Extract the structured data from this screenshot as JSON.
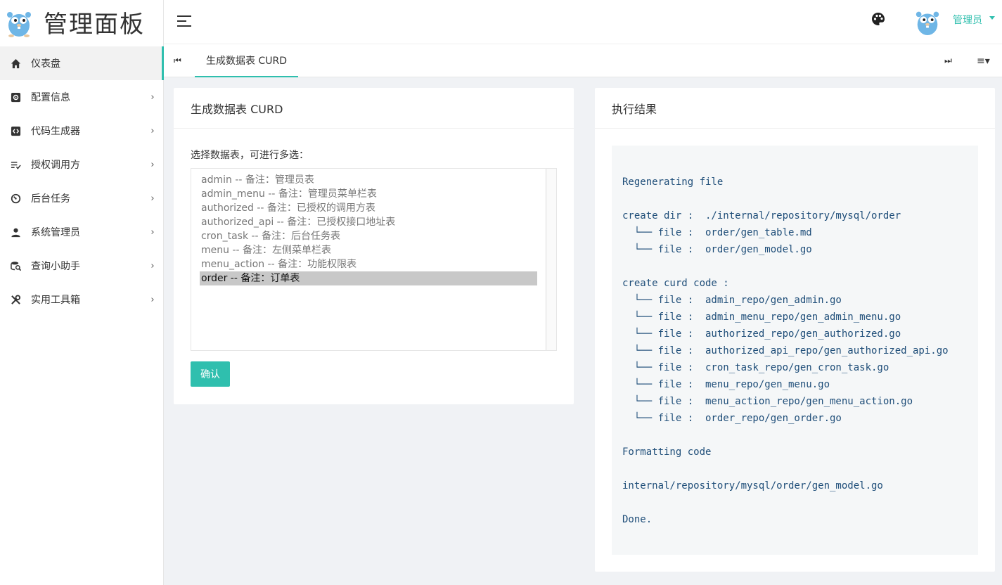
{
  "brand": {
    "title": "管理面板",
    "logo_icon": "gopher-logo-icon"
  },
  "sidebar": {
    "items": [
      {
        "label": "仪表盘",
        "icon": "home-icon",
        "active": true,
        "has_arrow": false
      },
      {
        "label": "配置信息",
        "icon": "settings-box-icon",
        "active": false,
        "has_arrow": true
      },
      {
        "label": "代码生成器",
        "icon": "code-icon",
        "active": false,
        "has_arrow": true
      },
      {
        "label": "授权调用方",
        "icon": "list-check-icon",
        "active": false,
        "has_arrow": true
      },
      {
        "label": "后台任务",
        "icon": "timer-icon",
        "active": false,
        "has_arrow": true
      },
      {
        "label": "系统管理员",
        "icon": "user-icon",
        "active": false,
        "has_arrow": true
      },
      {
        "label": "查询小助手",
        "icon": "search-database-icon",
        "active": false,
        "has_arrow": true
      },
      {
        "label": "实用工具箱",
        "icon": "tools-icon",
        "active": false,
        "has_arrow": true
      }
    ],
    "arrow": "›"
  },
  "header": {
    "user_name": "管理员"
  },
  "tabs": {
    "prev": "⏮",
    "next": "⏭",
    "menu": "≡▾",
    "items": [
      {
        "label": "生成数据表 CURD",
        "active": true
      }
    ]
  },
  "left_card": {
    "title": "生成数据表 CURD",
    "label": "选择数据表，可进行多选：",
    "options": [
      {
        "text": "admin -- 备注：管理员表",
        "selected": false
      },
      {
        "text": "admin_menu -- 备注：管理员菜单栏表",
        "selected": false
      },
      {
        "text": "authorized -- 备注：已授权的调用方表",
        "selected": false
      },
      {
        "text": "authorized_api -- 备注：已授权接口地址表",
        "selected": false
      },
      {
        "text": "cron_task -- 备注：后台任务表",
        "selected": false
      },
      {
        "text": "menu -- 备注：左侧菜单栏表",
        "selected": false
      },
      {
        "text": "menu_action -- 备注：功能权限表",
        "selected": false
      },
      {
        "text": "order -- 备注：订单表",
        "selected": true
      }
    ],
    "confirm_label": "确认"
  },
  "right_card": {
    "title": "执行结果",
    "lines": [
      "",
      "Regenerating file",
      "",
      "create dir :  ./internal/repository/mysql/order",
      "  └── file :  order/gen_table.md",
      "  └── file :  order/gen_model.go",
      "",
      "create curd code :",
      "  └── file :  admin_repo/gen_admin.go",
      "  └── file :  admin_menu_repo/gen_admin_menu.go",
      "  └── file :  authorized_repo/gen_authorized.go",
      "  └── file :  authorized_api_repo/gen_authorized_api.go",
      "  └── file :  cron_task_repo/gen_cron_task.go",
      "  └── file :  menu_repo/gen_menu.go",
      "  └── file :  menu_action_repo/gen_menu_action.go",
      "  └── file :  order_repo/gen_order.go",
      "",
      "Formatting code",
      "",
      "internal/repository/mysql/order/gen_model.go",
      "",
      "Done."
    ]
  },
  "colors": {
    "accent": "#2fbfae",
    "code_text": "#1f4e79",
    "background": "#f0f2f5"
  }
}
